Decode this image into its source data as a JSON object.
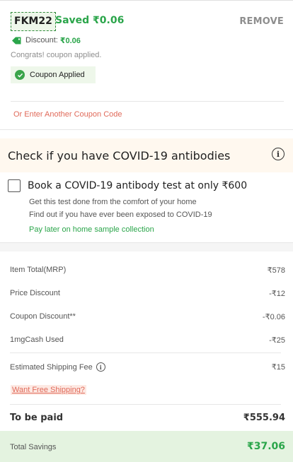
{
  "coupon": {
    "code": "FKM22",
    "saved_text": "Saved ₹0.06",
    "remove_label": "REMOVE",
    "discount_label": "Discount:",
    "discount_value": "₹0.06",
    "congrats_text": "Congrats! coupon applied.",
    "applied_label": "Coupon Applied",
    "another_link": "Or Enter Another Coupon Code",
    "accent_color": "#2aa54a"
  },
  "covid": {
    "title": "Check if you have COVID-19 antibodies",
    "checkbox_label": "Book a COVID-19 antibody test at only ₹600",
    "checked": false,
    "line1": "Get this test done from the comfort of your home",
    "line2": "Find out if you have ever been exposed to COVID-19",
    "pay_later": "Pay later on home sample collection"
  },
  "bill": {
    "rows": [
      {
        "label": "Item Total(MRP)",
        "value": "₹578"
      },
      {
        "label": "Price Discount",
        "value": "-₹12"
      },
      {
        "label": "Coupon Discount**",
        "value": "-₹0.06"
      },
      {
        "label": "1mgCash Used",
        "value": "-₹25"
      }
    ],
    "shipping_label": "Estimated Shipping Fee",
    "shipping_value": "₹15",
    "free_shipping_link": "Want Free Shipping?",
    "to_be_paid_label": "To be paid",
    "to_be_paid_value": "₹555.94",
    "savings_label": "Total Savings",
    "savings_value": "₹37.06"
  },
  "icons": {
    "tag": "tag-icon",
    "check": "check-circle-icon",
    "info": "info-icon"
  }
}
